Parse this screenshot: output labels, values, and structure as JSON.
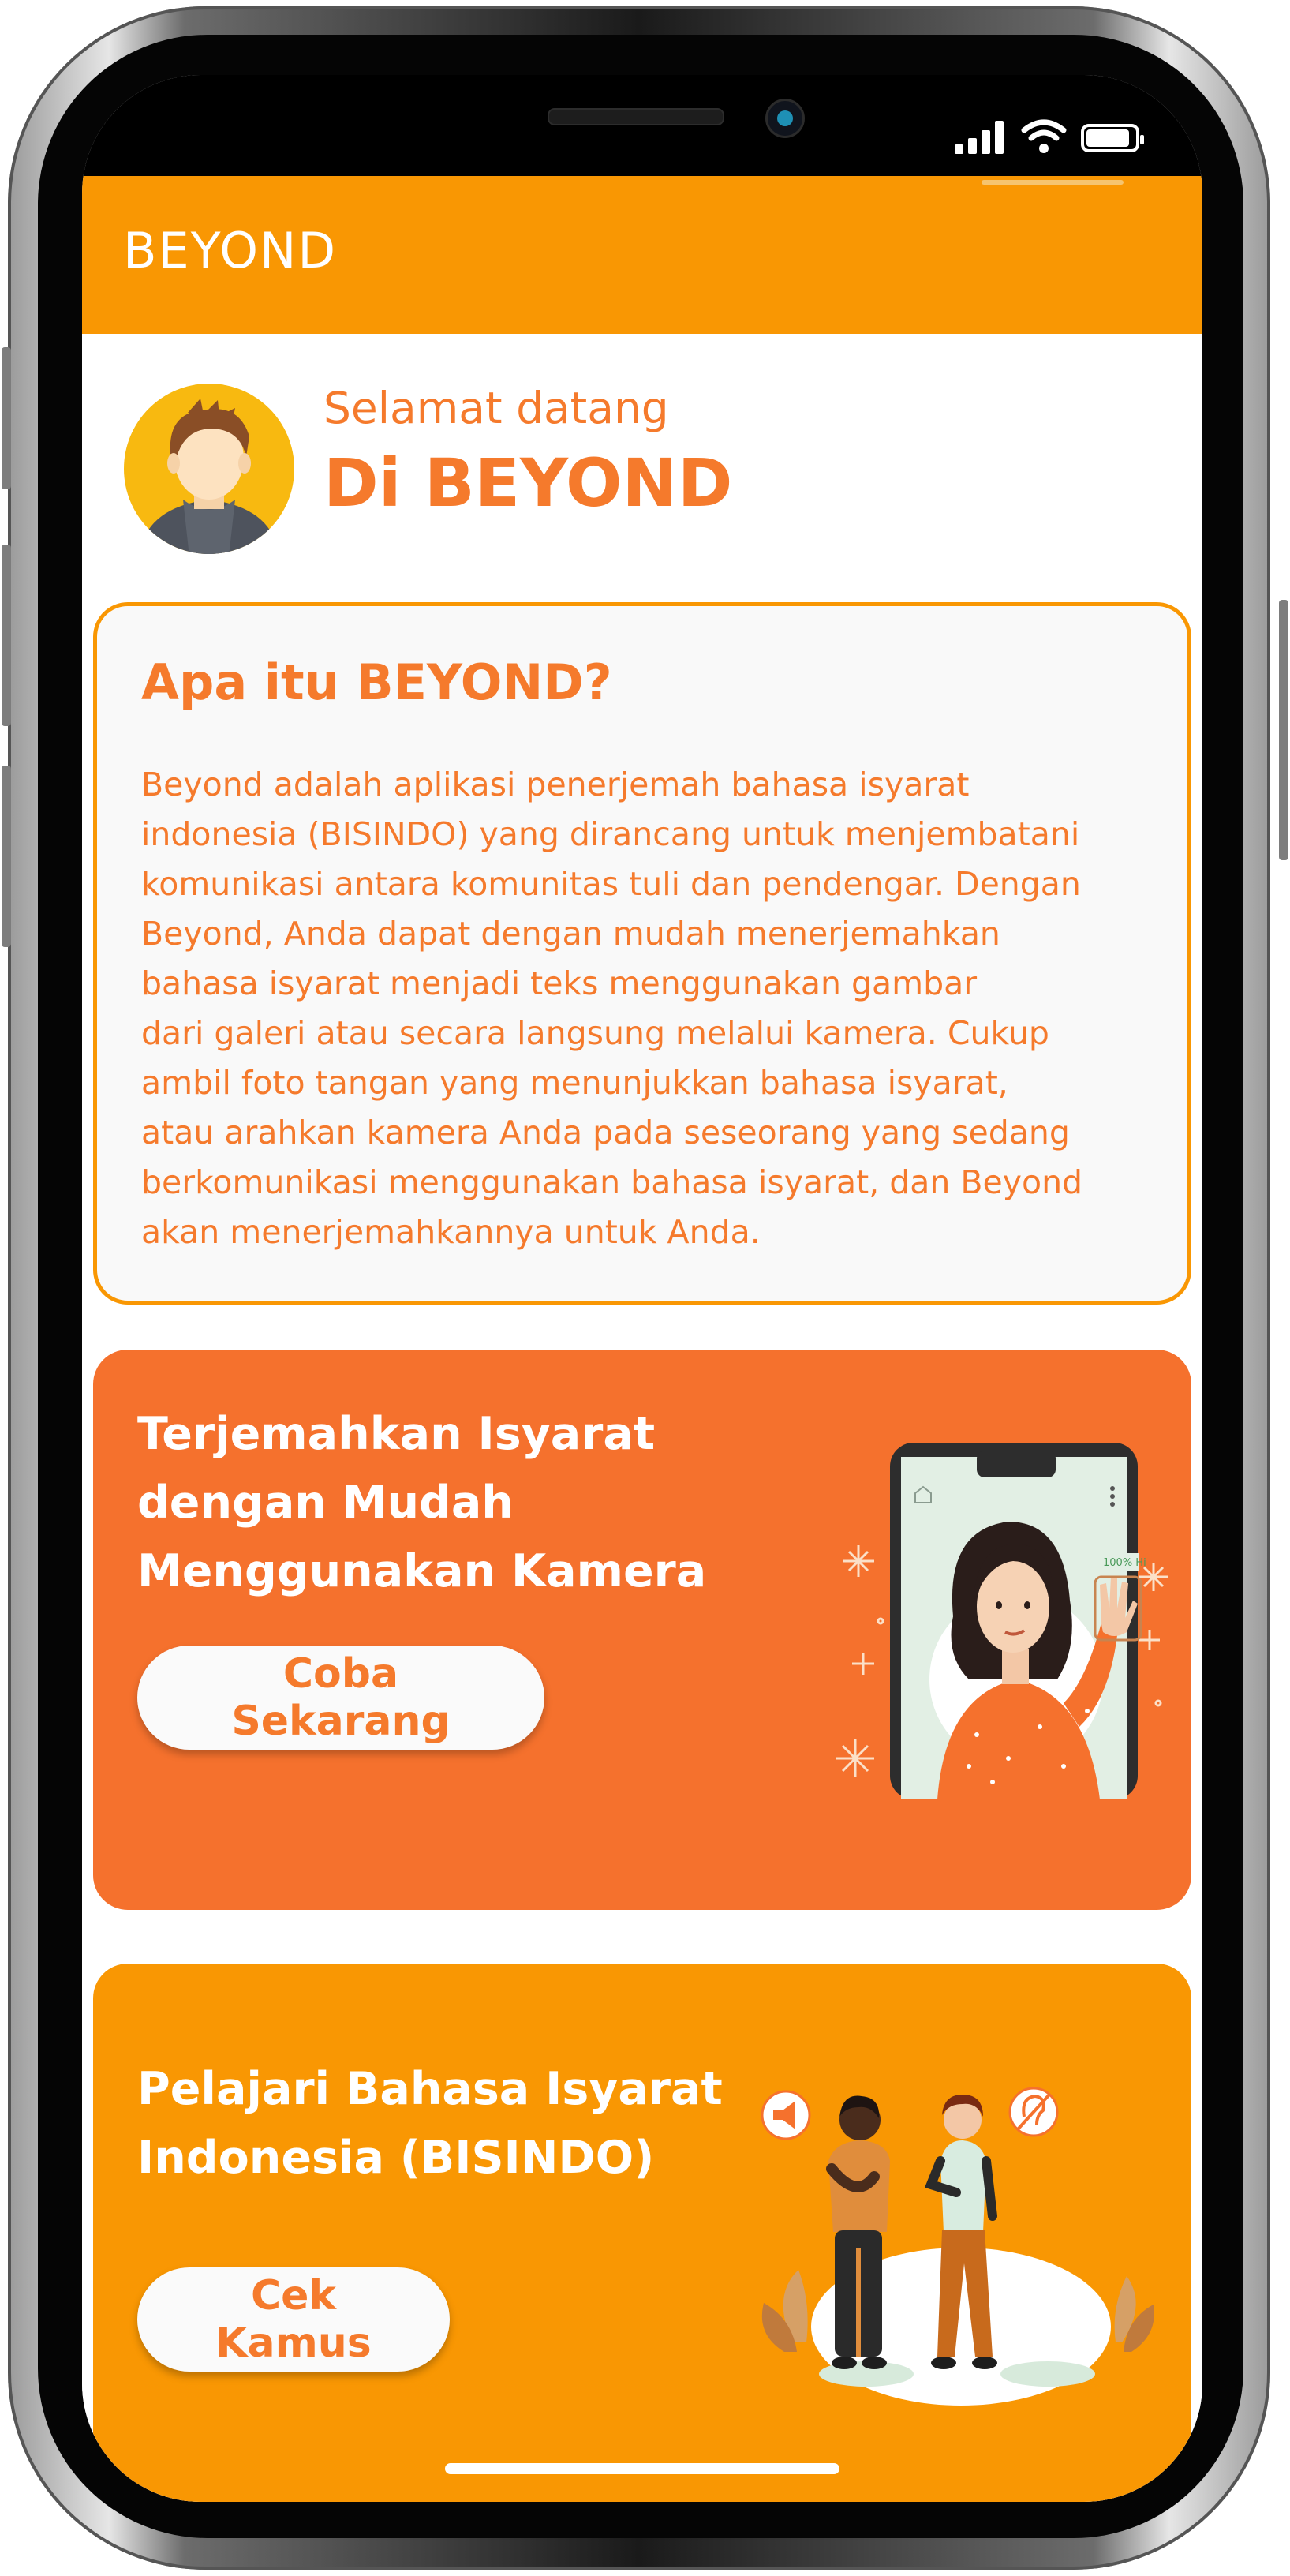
{
  "app": {
    "title": "BEYOND"
  },
  "greeting": {
    "subtitle": "Selamat datang",
    "title": "Di BEYOND"
  },
  "about": {
    "title": "Apa itu BEYOND?",
    "body_lines": [
      "Beyond adalah aplikasi penerjemah bahasa isyarat",
      "indonesia (BISINDO) yang dirancang untuk menjembatani",
      "komunikasi antara komunitas tuli dan pendengar. Dengan",
      "Beyond, Anda dapat dengan mudah menerjemahkan",
      "bahasa isyarat menjadi teks menggunakan gambar",
      "dari galeri atau secara langsung melalui kamera. Cukup",
      "ambil foto tangan yang menunjukkan bahasa isyarat,",
      "atau arahkan kamera Anda pada seseorang yang sedang",
      "berkomunikasi menggunakan bahasa isyarat, dan Beyond",
      "akan menerjemahkannya untuk Anda."
    ]
  },
  "translate_card": {
    "heading_lines": [
      "Terjemahkan Isyarat",
      "dengan Mudah",
      "Menggunakan Kamera"
    ],
    "button_label": "Coba Sekarang",
    "illustration_text": "100% Hi"
  },
  "learn_card": {
    "heading_lines": [
      "Pelajari Bahasa Isyarat",
      "Indonesia (BISINDO)"
    ],
    "button_label": "Cek Kamus"
  },
  "colors": {
    "primary_orange": "#f99703",
    "accent_orange": "#f5712d",
    "text_orange": "#f57a2c",
    "card_background": "#f9f9f9"
  },
  "icons": [
    "signal-icon",
    "wifi-icon",
    "battery-icon",
    "avatar-icon",
    "home-icon",
    "more-icon",
    "megaphone-icon",
    "no-hearing-icon"
  ]
}
